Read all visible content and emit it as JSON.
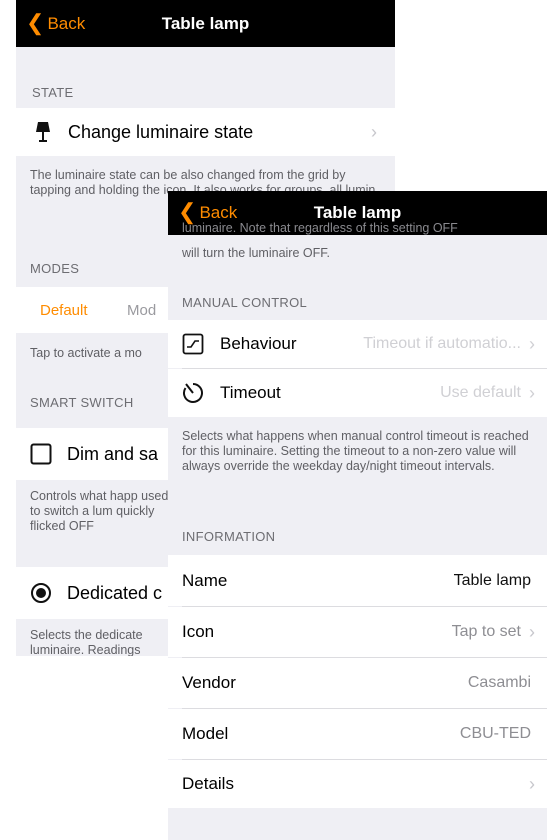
{
  "back_screen": {
    "nav": {
      "back_label": "Back",
      "title": "Table lamp"
    },
    "state_header": "STATE",
    "change_state_label": "Change luminaire state",
    "state_footer": "The luminaire state can be also changed from the grid by tapping and holding the icon. It also works for groups, all lumin",
    "modes_header": "MODES",
    "modes_tabs": [
      "Default",
      "Mod"
    ],
    "modes_footer": "Tap to activate a mo",
    "smart_switch_header": "SMART SWITCH",
    "dim_label": "Dim and sa",
    "smart_footer": "Controls what happ used to switch a lum quickly flicked OFF",
    "dedicated_label": "Dedicated c",
    "dedicated_footer": "Selects the dedicate luminaire. Readings"
  },
  "front_screen": {
    "nav": {
      "back_label": "Back",
      "title": "Table lamp"
    },
    "top_footer_cut": "luminaire. Note that regardless of this setting OFF",
    "top_footer": "will turn the luminaire OFF.",
    "manual_header": "MANUAL CONTROL",
    "behaviour": {
      "label": "Behaviour",
      "value": "Timeout if automatio..."
    },
    "timeout": {
      "label": "Timeout",
      "value": "Use default"
    },
    "manual_footer": "Selects what happens when manual control timeout is reached for this luminaire. Setting the timeout to a non-zero value will always override the weekday day/night timeout intervals.",
    "information_header": "INFORMATION",
    "info_rows": [
      {
        "label": "Name",
        "value": "Table lamp"
      },
      {
        "label": "Icon",
        "value": "Tap to set"
      },
      {
        "label": "Vendor",
        "value": "Casambi"
      },
      {
        "label": "Model",
        "value": "CBU-TED"
      },
      {
        "label": "Details",
        "value": ""
      }
    ]
  },
  "colors": {
    "accent": "#ff8c00",
    "nav_bg": "#000000",
    "group_bg": "#efeff4"
  }
}
